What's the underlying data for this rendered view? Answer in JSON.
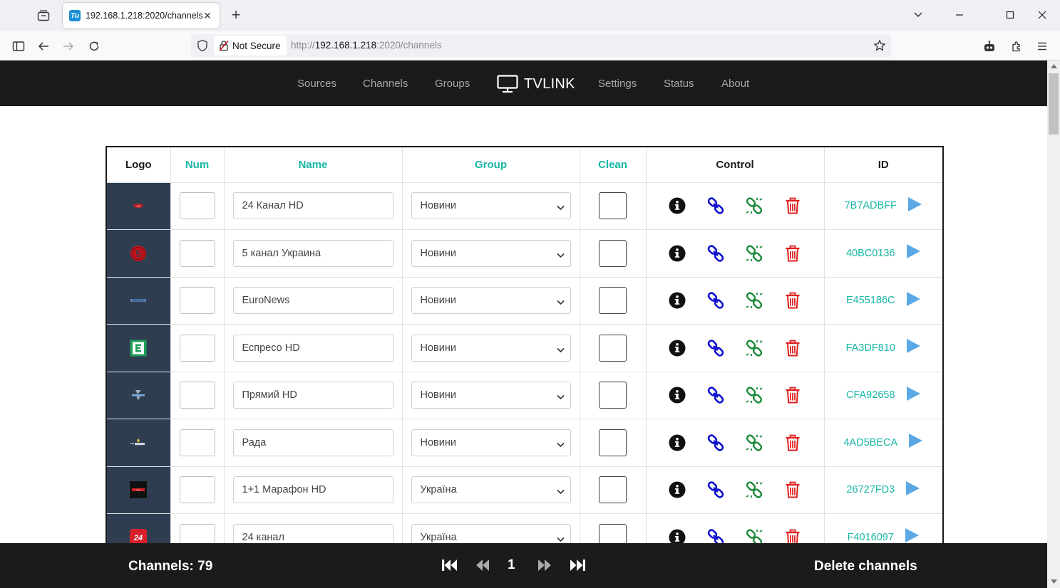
{
  "browser": {
    "tab_title": "192.168.1.218:2020/channels",
    "tab_favicon_text": "Tu",
    "security_label": "Not Secure",
    "url_prefix": "http://",
    "url_host": "192.168.1.218",
    "url_rest": ":2020/channels"
  },
  "site": {
    "brand": "TVLINK",
    "nav": [
      "Sources",
      "Channels",
      "Groups",
      "Settings",
      "Status",
      "About"
    ]
  },
  "table": {
    "headers": [
      "Logo",
      "Num",
      "Name",
      "Group",
      "Clean",
      "Control",
      "ID"
    ],
    "rows": [
      {
        "name": "24 Канал HD",
        "group": "Новини",
        "id": "7B7ADBFF",
        "logo": "logo-24-kanal-hd"
      },
      {
        "name": "5 канал Украина",
        "group": "Новини",
        "id": "40BC0136",
        "logo": "logo-5-kanal"
      },
      {
        "name": "EuroNews",
        "group": "Новини",
        "id": "E455186C",
        "logo": "logo-euronews"
      },
      {
        "name": "Еспресо HD",
        "group": "Новини",
        "id": "FA3DF810",
        "logo": "logo-espreso"
      },
      {
        "name": "Прямий HD",
        "group": "Новини",
        "id": "CFA92658",
        "logo": "logo-pryamiy"
      },
      {
        "name": "Рада",
        "group": "Новини",
        "id": "4AD5BECA",
        "logo": "logo-rada"
      },
      {
        "name": "1+1 Марафон HD",
        "group": "Україна",
        "id": "26727FD3",
        "logo": "logo-1plus1-marafon"
      },
      {
        "name": "24 канал",
        "group": "Україна",
        "id": "F4016097",
        "logo": "logo-24-kanal"
      }
    ]
  },
  "footer": {
    "channels_label": "Channels: 79",
    "page": "1",
    "delete_label": "Delete channels"
  },
  "colors": {
    "accent_teal": "#17b6a5",
    "link_blue": "#1010d0",
    "refresh_green": "#1a8a3a",
    "delete_red": "#e02020",
    "play_blue": "#5aa9e6",
    "header_dark": "#1b1b1b",
    "logo_bg": "#2e3e50"
  }
}
